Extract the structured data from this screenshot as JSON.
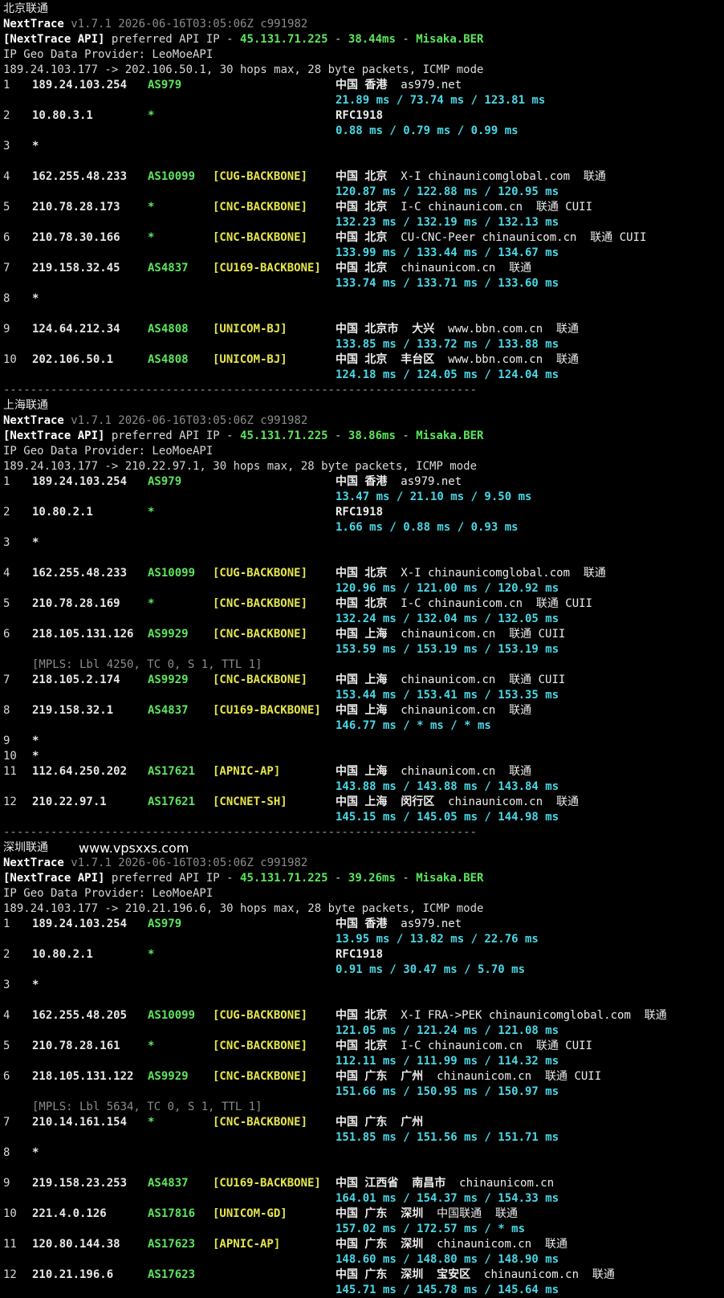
{
  "watermark": "www.vpsxxs.com",
  "colors": {
    "background": "#000000",
    "text": "#d8d8d8",
    "as_green": "#5ce65c",
    "tag_yellow": "#e6e64c",
    "rtt_cyan": "#4ad8e6",
    "dim_gray": "#8c8c8c"
  },
  "separator": "----------------------------------------------------------------------",
  "sections": [
    {
      "title": "北京联通",
      "app_name": "NextTrace",
      "version": "v1.7.1 2026-06-16T03:05:06Z c991982",
      "api_label": "[NextTrace API]",
      "api_text": " preferred API IP - ",
      "api_ip": "45.131.71.225",
      "api_dash1": " - ",
      "api_latency": "38.44ms",
      "api_dash2": " - ",
      "api_node": "Misaka.BER",
      "geo_provider": "IP Geo Data Provider: LeoMoeAPI",
      "trace_line": "189.24.103.177 -> 202.106.50.1, 30 hops max, 28 byte packets, ICMP mode",
      "hops": [
        {
          "hop": "1",
          "ip": "189.24.103.254",
          "asn": "AS979",
          "tag": "",
          "geo": "中国 香港",
          "domain": "as979.net",
          "rtt": "21.89 ms / 73.74 ms / 123.81 ms"
        },
        {
          "hop": "2",
          "ip": "10.80.3.1",
          "asn": "*",
          "tag": "",
          "geo": "RFC1918",
          "domain": "",
          "rtt": "0.88 ms / 0.79 ms / 0.99 ms"
        },
        {
          "hop": "3",
          "ip": "*",
          "asn": "",
          "tag": "",
          "geo": "",
          "domain": "",
          "rtt": ""
        },
        {
          "hop": "4",
          "ip": "162.255.48.233",
          "asn": "AS10099",
          "tag": "[CUG-BACKBONE]",
          "geo": "中国 北京",
          "domain": "X-I chinaunicomglobal.com  联通",
          "rtt": "120.87 ms / 122.88 ms / 120.95 ms"
        },
        {
          "hop": "5",
          "ip": "210.78.28.173",
          "asn": "*",
          "tag": "[CNC-BACKBONE]",
          "geo": "中国 北京",
          "domain": "I-C chinaunicom.cn  联通 CUII",
          "rtt": "132.23 ms / 132.19 ms / 132.13 ms"
        },
        {
          "hop": "6",
          "ip": "210.78.30.166",
          "asn": "*",
          "tag": "[CNC-BACKBONE]",
          "geo": "中国 北京",
          "domain": "CU-CNC-Peer chinaunicom.cn  联通 CUII",
          "rtt": "133.99 ms / 133.44 ms / 134.67 ms"
        },
        {
          "hop": "7",
          "ip": "219.158.32.45",
          "asn": "AS4837",
          "tag": "[CU169-BACKBONE]",
          "geo": "中国 北京",
          "domain": "chinaunicom.cn  联通",
          "rtt": "133.74 ms / 133.71 ms / 133.60 ms"
        },
        {
          "hop": "8",
          "ip": "*",
          "asn": "",
          "tag": "",
          "geo": "",
          "domain": "",
          "rtt": ""
        },
        {
          "hop": "9",
          "ip": "124.64.212.34",
          "asn": "AS4808",
          "tag": "[UNICOM-BJ]",
          "geo": "中国 北京市  大兴",
          "domain": "www.bbn.com.cn  联通",
          "rtt": "133.85 ms / 133.72 ms / 133.88 ms"
        },
        {
          "hop": "10",
          "ip": "202.106.50.1",
          "asn": "AS4808",
          "tag": "[UNICOM-BJ]",
          "geo": "中国 北京  丰台区",
          "domain": "www.bbn.com.cn  联通",
          "rtt": "124.18 ms / 124.05 ms / 124.04 ms"
        }
      ]
    },
    {
      "title": "上海联通",
      "app_name": "NextTrace",
      "version": "v1.7.1 2026-06-16T03:05:06Z c991982",
      "api_label": "[NextTrace API]",
      "api_text": " preferred API IP - ",
      "api_ip": "45.131.71.225",
      "api_dash1": " - ",
      "api_latency": "38.86ms",
      "api_dash2": " - ",
      "api_node": "Misaka.BER",
      "geo_provider": "IP Geo Data Provider: LeoMoeAPI",
      "trace_line": "189.24.103.177 -> 210.22.97.1, 30 hops max, 28 byte packets, ICMP mode",
      "hops": [
        {
          "hop": "1",
          "ip": "189.24.103.254",
          "asn": "AS979",
          "tag": "",
          "geo": "中国 香港",
          "domain": "as979.net",
          "rtt": "13.47 ms / 21.10 ms / 9.50 ms"
        },
        {
          "hop": "2",
          "ip": "10.80.2.1",
          "asn": "*",
          "tag": "",
          "geo": "RFC1918",
          "domain": "",
          "rtt": "1.66 ms / 0.88 ms / 0.93 ms"
        },
        {
          "hop": "3",
          "ip": "*",
          "asn": "",
          "tag": "",
          "geo": "",
          "domain": "",
          "rtt": ""
        },
        {
          "hop": "4",
          "ip": "162.255.48.233",
          "asn": "AS10099",
          "tag": "[CUG-BACKBONE]",
          "geo": "中国 北京",
          "domain": "X-I chinaunicomglobal.com  联通",
          "rtt": "120.96 ms / 121.00 ms / 120.92 ms"
        },
        {
          "hop": "5",
          "ip": "210.78.28.169",
          "asn": "*",
          "tag": "[CNC-BACKBONE]",
          "geo": "中国 北京",
          "domain": "I-C chinaunicom.cn  联通 CUII",
          "rtt": "132.24 ms / 132.04 ms / 132.05 ms"
        },
        {
          "hop": "6",
          "ip": "218.105.131.126",
          "asn": "AS9929",
          "tag": "[CNC-BACKBONE]",
          "geo": "中国 上海",
          "domain": "chinaunicom.cn  联通 CUII",
          "rtt": "153.59 ms / 153.19 ms / 153.19 ms",
          "mpls": "[MPLS: Lbl 4250, TC 0, S 1, TTL 1]"
        },
        {
          "hop": "7",
          "ip": "218.105.2.174",
          "asn": "AS9929",
          "tag": "[CNC-BACKBONE]",
          "geo": "中国 上海",
          "domain": "chinaunicom.cn  联通 CUII",
          "rtt": "153.44 ms / 153.41 ms / 153.35 ms"
        },
        {
          "hop": "8",
          "ip": "219.158.32.1",
          "asn": "AS4837",
          "tag": "[CU169-BACKBONE]",
          "geo": "中国 上海",
          "domain": "chinaunicom.cn  联通",
          "rtt": "146.77 ms / * ms / * ms"
        },
        {
          "hop": "9",
          "ip": "*",
          "asn": "",
          "tag": "",
          "geo": "",
          "domain": "",
          "rtt": "",
          "compact": true
        },
        {
          "hop": "10",
          "ip": "*",
          "asn": "",
          "tag": "",
          "geo": "",
          "domain": "",
          "rtt": "",
          "compact": true
        },
        {
          "hop": "11",
          "ip": "112.64.250.202",
          "asn": "AS17621",
          "tag": "[APNIC-AP]",
          "geo": "中国 上海",
          "domain": "chinaunicom.cn  联通",
          "rtt": "143.88 ms / 143.88 ms / 143.84 ms"
        },
        {
          "hop": "12",
          "ip": "210.22.97.1",
          "asn": "AS17621",
          "tag": "[CNCNET-SH]",
          "geo": "中国 上海  闵行区",
          "domain": "chinaunicom.cn  联通",
          "rtt": "145.15 ms / 145.05 ms / 144.98 ms"
        }
      ]
    },
    {
      "title": "深圳联通",
      "app_name": "NextTrace",
      "version": "v1.7.1 2026-06-16T03:05:06Z c991982",
      "api_label": "[NextTrace API]",
      "api_text": " preferred API IP - ",
      "api_ip": "45.131.71.225",
      "api_dash1": " - ",
      "api_latency": "39.26ms",
      "api_dash2": " - ",
      "api_node": "Misaka.BER",
      "geo_provider": "IP Geo Data Provider: LeoMoeAPI",
      "trace_line": "189.24.103.177 -> 210.21.196.6, 30 hops max, 28 byte packets, ICMP mode",
      "hops": [
        {
          "hop": "1",
          "ip": "189.24.103.254",
          "asn": "AS979",
          "tag": "",
          "geo": "中国 香港",
          "domain": "as979.net",
          "rtt": "13.95 ms / 13.82 ms / 22.76 ms"
        },
        {
          "hop": "2",
          "ip": "10.80.2.1",
          "asn": "*",
          "tag": "",
          "geo": "RFC1918",
          "domain": "",
          "rtt": "0.91 ms / 30.47 ms / 5.70 ms"
        },
        {
          "hop": "3",
          "ip": "*",
          "asn": "",
          "tag": "",
          "geo": "",
          "domain": "",
          "rtt": ""
        },
        {
          "hop": "4",
          "ip": "162.255.48.205",
          "asn": "AS10099",
          "tag": "[CUG-BACKBONE]",
          "geo": "中国 北京",
          "domain": "X-I FRA->PEK chinaunicomglobal.com  联通",
          "rtt": "121.05 ms / 121.24 ms / 121.08 ms"
        },
        {
          "hop": "5",
          "ip": "210.78.28.161",
          "asn": "*",
          "tag": "[CNC-BACKBONE]",
          "geo": "中国 北京",
          "domain": "I-C chinaunicom.cn  联通 CUII",
          "rtt": "112.11 ms / 111.99 ms / 114.32 ms"
        },
        {
          "hop": "6",
          "ip": "218.105.131.122",
          "asn": "AS9929",
          "tag": "[CNC-BACKBONE]",
          "geo": "中国 广东  广州",
          "domain": "chinaunicom.cn  联通 CUII",
          "rtt": "151.66 ms / 150.95 ms / 150.97 ms",
          "mpls": "[MPLS: Lbl 5634, TC 0, S 1, TTL 1]"
        },
        {
          "hop": "7",
          "ip": "210.14.161.154",
          "asn": "*",
          "tag": "[CNC-BACKBONE]",
          "geo": "中国 广东  广州",
          "domain": "",
          "rtt": "151.85 ms / 151.56 ms / 151.71 ms"
        },
        {
          "hop": "8",
          "ip": "*",
          "asn": "",
          "tag": "",
          "geo": "",
          "domain": "",
          "rtt": ""
        },
        {
          "hop": "9",
          "ip": "219.158.23.253",
          "asn": "AS4837",
          "tag": "[CU169-BACKBONE]",
          "geo": "中国 江西省  南昌市",
          "domain": "chinaunicom.cn",
          "rtt": "164.01 ms / 154.37 ms / 154.33 ms"
        },
        {
          "hop": "10",
          "ip": "221.4.0.126",
          "asn": "AS17816",
          "tag": "[UNICOM-GD]",
          "geo": "中国 广东  深圳",
          "domain": "中国联通  联通",
          "rtt": "157.02 ms / 172.57 ms / * ms"
        },
        {
          "hop": "11",
          "ip": "120.80.144.38",
          "asn": "AS17623",
          "tag": "[APNIC-AP]",
          "geo": "中国 广东  深圳",
          "domain": "chinaunicom.cn  联通",
          "rtt": "148.60 ms / 148.80 ms / 148.90 ms"
        },
        {
          "hop": "12",
          "ip": "210.21.196.6",
          "asn": "AS17623",
          "tag": "",
          "geo": "中国 广东  深圳  宝安区",
          "domain": "chinaunicom.cn  联通",
          "rtt": "145.71 ms / 145.78 ms / 145.64 ms"
        }
      ]
    }
  ]
}
